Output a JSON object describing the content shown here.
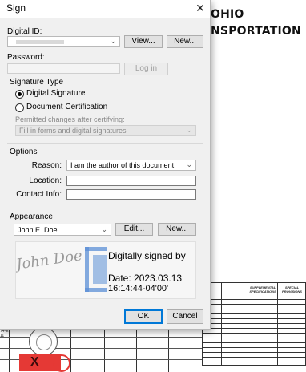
{
  "background": {
    "heading_line1": "OHIO",
    "heading_line2": "NSPORTATION",
    "table_headers": [
      "SUPPLEMENTAL SPECIFICATIONS",
      "SPECIAL PROVISIONS"
    ],
    "side_label_line1": "74-E",
    "side_label_line2": "11",
    "redbox_mark": "X"
  },
  "dialog": {
    "title": "Sign",
    "close_glyph": "✕",
    "digital_id": {
      "label": "Digital ID:",
      "value": "",
      "view_button": "View...",
      "new_button": "New..."
    },
    "password": {
      "label": "Password:",
      "value": "",
      "login_button": "Log in"
    },
    "signature_type": {
      "heading": "Signature Type",
      "option_digital": "Digital Signature",
      "option_certification": "Document Certification",
      "selected": "Digital Signature",
      "permitted_label": "Permitted changes after certifying:",
      "permitted_value": "Fill in forms and digital signatures"
    },
    "options": {
      "heading": "Options",
      "reason_label": "Reason:",
      "reason_value": "I am the author of this document",
      "location_label": "Location:",
      "location_value": "",
      "contact_label": "Contact Info:",
      "contact_value": ""
    },
    "appearance": {
      "heading": "Appearance",
      "value": "John E. Doe",
      "edit_button": "Edit...",
      "new_button": "New..."
    },
    "preview": {
      "script_name": "John Doe",
      "line1": "Digitally signed by",
      "line2": "",
      "line3": "Date: 2023.03.13",
      "line4": "16:14:44-04'00'"
    },
    "ok_button": "OK",
    "cancel_button": "Cancel"
  },
  "colors": {
    "accent": "#0078d7",
    "logo_blue": "#5b8fd6",
    "red": "#e53935"
  }
}
